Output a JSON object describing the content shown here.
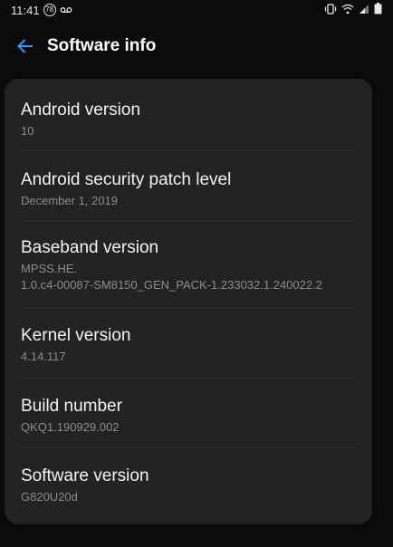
{
  "status_bar": {
    "time": "11:41",
    "badge_count": "78",
    "icons": [
      "notification-badge-icon",
      "voicemail-icon",
      "vibrate-icon",
      "wifi-icon",
      "signal-icon",
      "battery-icon"
    ]
  },
  "app_bar": {
    "title": "Software info",
    "back_icon": "arrow-left-icon",
    "accent_color": "#2b9ff0"
  },
  "items": [
    {
      "label": "Android version",
      "value": "10"
    },
    {
      "label": "Android security patch level",
      "value": "December 1, 2019"
    },
    {
      "label": "Baseband version",
      "value": "MPSS.HE.\n1.0.c4-00087-SM8150_GEN_PACK-1.233032.1.240022.2"
    },
    {
      "label": "Kernel version",
      "value": "4.14.117"
    },
    {
      "label": "Build number",
      "value": "QKQ1.190929.002"
    },
    {
      "label": "Software version",
      "value": "G820U20d"
    }
  ]
}
